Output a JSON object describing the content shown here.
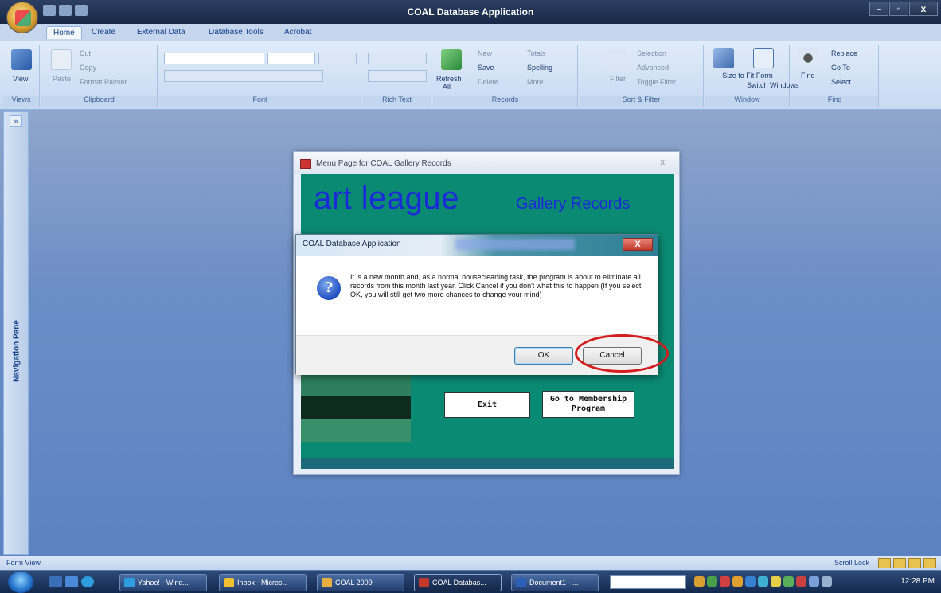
{
  "app": {
    "title": "COAL Database Application"
  },
  "ribbon": {
    "tabs": [
      "Home",
      "Create",
      "External Data",
      "Database Tools",
      "Acrobat"
    ],
    "groups": {
      "views": {
        "label": "Views",
        "view": "View"
      },
      "clipboard": {
        "label": "Clipboard",
        "paste": "Paste",
        "cut": "Cut",
        "copy": "Copy",
        "format_painter": "Format Painter"
      },
      "font": {
        "label": "Font"
      },
      "rich_text": {
        "label": "Rich Text"
      },
      "records": {
        "label": "Records",
        "refresh": "Refresh",
        "refresh_sub": "All",
        "new": "New",
        "save": "Save",
        "delete": "Delete",
        "totals": "Totals",
        "spelling": "Spelling",
        "more": "More"
      },
      "sort_filter": {
        "label": "Sort & Filter",
        "filter": "Filter",
        "selection": "Selection",
        "advanced": "Advanced",
        "toggle_filter": "Toggle Filter"
      },
      "window": {
        "label": "Window",
        "size_to_fit": "Size to Fit Form",
        "switch": "Switch Windows"
      },
      "find": {
        "label": "Find",
        "find": "Find",
        "replace": "Replace",
        "goto": "Go To",
        "select": "Select"
      }
    }
  },
  "nav_pane": {
    "label": "Navigation Pane",
    "toggle": "»"
  },
  "form": {
    "title": "Menu Page for COAL Gallery Records",
    "close": "x",
    "heading": "art league",
    "subheading": "Gallery Records",
    "exit_button": "Exit",
    "membership_button": "Go to Membership Program"
  },
  "dialog": {
    "title": "COAL Database Application",
    "close": "X",
    "icon": "?",
    "message": "It is a new month and, as a normal housecleaning task, the program is about to eliminate all records from this month last year.  Click Cancel if you don't what this to happen  (If you select OK, you will still get two more chances to change your mind)",
    "ok": "OK",
    "cancel": "Cancel"
  },
  "status_bar": {
    "left": "Form View",
    "right": "Scroll Lock"
  },
  "taskbar": {
    "items": [
      "Yahoo! - Wind...",
      "Inbox - Micros...",
      "COAL 2009",
      "COAL Databas...",
      "Document1 - ..."
    ],
    "active_index": 3,
    "clock": "12:28 PM"
  }
}
